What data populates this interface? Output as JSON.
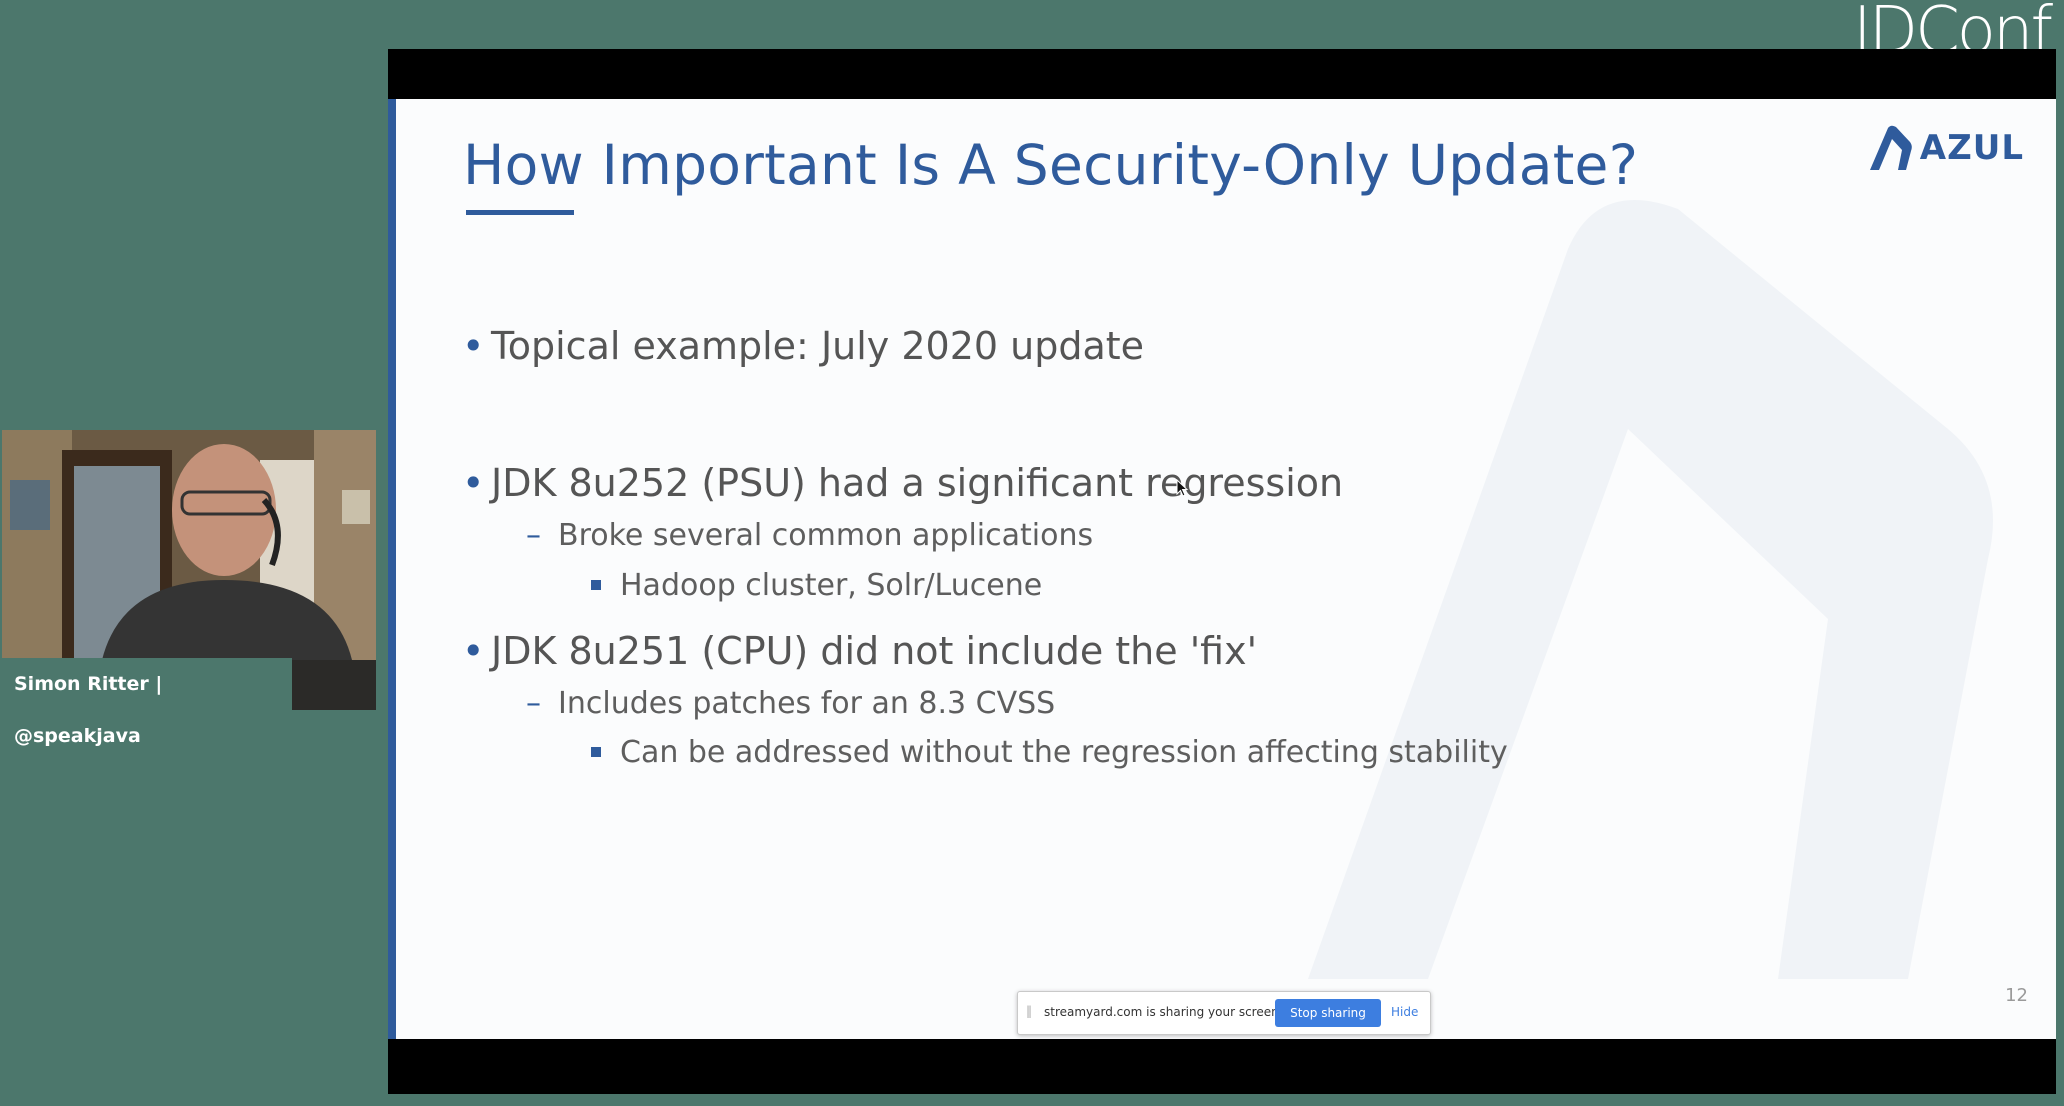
{
  "brand": {
    "name": "JDConf"
  },
  "presenter": {
    "label": "Simon Ritter | @speakjava"
  },
  "slide": {
    "title": "How Important Is A Security-Only Update?",
    "logo_text": "AZUL",
    "page_number": "12",
    "bullets": [
      {
        "text": "Topical example: July 2020 update"
      },
      {
        "text": "JDK 8u252 (PSU) had a significant regression"
      },
      {
        "text": "Broke several common applications"
      },
      {
        "text": "Hadoop cluster, Solr/Lucene"
      },
      {
        "text": "JDK 8u251 (CPU) did not include the 'fix'"
      },
      {
        "text": "Includes patches for an 8.3 CVSS"
      },
      {
        "text": "Can be addressed without the regression affecting stability"
      }
    ],
    "markers": {
      "level1": "•",
      "level2": "–"
    }
  },
  "share_bar": {
    "grip": "||",
    "message": "streamyard.com is sharing your screen.",
    "stop_label": "Stop sharing",
    "hide_label": "Hide"
  },
  "colors": {
    "background": "#4c776c",
    "slide_accent": "#2f5b9c",
    "stop_button": "#3d7ee0"
  },
  "icons": [
    "azul-logo-icon",
    "mouse-cursor-icon",
    "drag-grip-icon"
  ]
}
